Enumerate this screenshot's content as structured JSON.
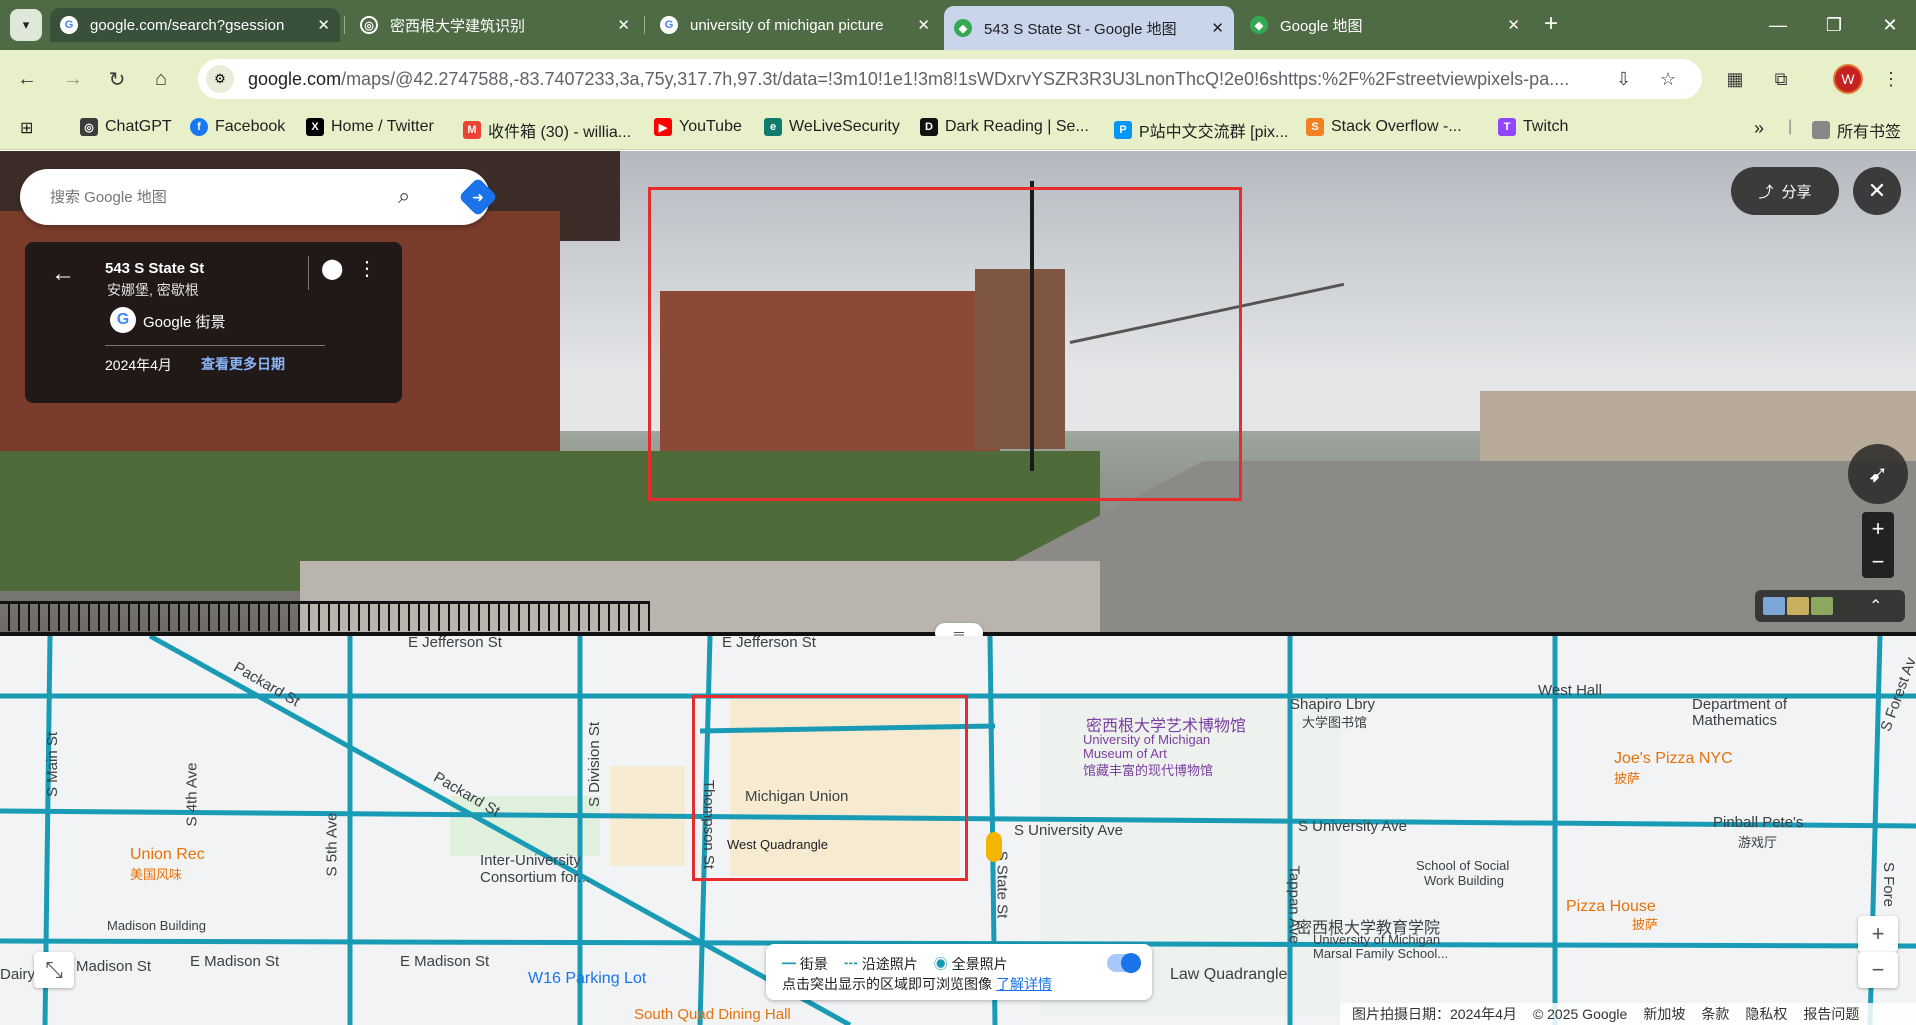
{
  "tabs": [
    {
      "title": "google.com/search?gsession",
      "close": "✕"
    },
    {
      "title": "密西根大学建筑识别",
      "close": "✕"
    },
    {
      "title": "university of michigan picture",
      "close": "✕"
    },
    {
      "title": "543 S State St - Google 地图",
      "close": "✕"
    },
    {
      "title": "Google 地图",
      "close": "✕"
    }
  ],
  "new_tab": "+",
  "address_bar": {
    "host": "google.com",
    "path": "/maps/@42.2747588,-83.7407233,3a,75y,317.7h,97.3t/data=!3m10!1e1!3m8!1sWDxrvYSZR3R3U3LnonThcQ!2e0!6shttps:%2F%2Fstreetviewpixels-pa...."
  },
  "profile_initial": "W",
  "bookmarks": [
    {
      "label": "ChatGPT",
      "color": "#3c3c3c"
    },
    {
      "label": "Facebook",
      "color": "#1877f2"
    },
    {
      "label": "Home / Twitter",
      "color": "#000000"
    },
    {
      "label": "收件箱 (30) - willia...",
      "color": "#ea4335"
    },
    {
      "label": "YouTube",
      "color": "#ff0000"
    },
    {
      "label": "WeLiveSecurity",
      "color": "#0f7b6c"
    },
    {
      "label": "Dark Reading | Se...",
      "color": "#111111"
    },
    {
      "label": "P站中文交流群 [pix...",
      "color": "#0096fa"
    },
    {
      "label": "Stack Overflow -...",
      "color": "#f48024"
    },
    {
      "label": "Twitch",
      "color": "#9146ff"
    }
  ],
  "bookmarks_overflow": "»",
  "all_bookmarks": "所有书签",
  "search": {
    "placeholder": "搜索 Google 地图"
  },
  "info_card": {
    "address": "543 S State St",
    "city": "安娜堡, 密歇根",
    "source": "Google 街景",
    "date": "2024年4月",
    "more_dates": "查看更多日期"
  },
  "share_label": "分享",
  "map_labels": {
    "e_jefferson_1": "E Jefferson St",
    "e_jefferson_2": "E Jefferson St",
    "packard_1": "Packard St",
    "packard_2": "Packard St",
    "s_main": "S Main St",
    "s_4th": "S 4th Ave",
    "s_5th": "S 5th Ave",
    "s_division": "S Division St",
    "thompson": "Thompson St",
    "s_state": "S State St",
    "s_university_1": "S University Ave",
    "s_university_2": "S University Ave",
    "tappan": "Tappan Ave",
    "e_madison_1": "E Madison St",
    "e_madison_2": "E Madison St",
    "madison_left": "Madison St",
    "dairy": "Dairy",
    "michigan_union": "Michigan Union",
    "west_quad": "West Quadrangle",
    "museum_cn": "密西根大学艺术博物馆",
    "museum_en1": "University of Michigan",
    "museum_en2": "Museum of Art",
    "museum_cn2": "馆藏丰富的现代博物馆",
    "shapiro": "Shapiro Lbry",
    "shapiro_cn": "大学图书馆",
    "west_hall": "West Hall",
    "dept_math1": "Department of",
    "dept_math2": "Mathematics",
    "joes": "Joe's Pizza NYC",
    "joes_cn": "披萨",
    "pinball": "Pinball Pete's",
    "pinball_cn": "游戏厅",
    "union_rec": "Union Rec",
    "union_rec_cn": "美国风味",
    "icpsr1": "Inter-University",
    "icpsr2": "Consortium for...",
    "madison_bldg": "Madison Building",
    "school_social1": "School of Social",
    "school_social2": "Work Building",
    "edu_cn": "密西根大学教育学院",
    "edu_en1": "University of Michigan",
    "edu_en2": "Marsal Family School...",
    "pizza_house": "Pizza House",
    "pizza_house_cn": "披萨",
    "w16": "W16 Parking Lot",
    "law_quad": "Law Quadrangle",
    "south_quad": "South Quad Dining Hall",
    "s_forest": "S Forest Av",
    "s_fore2": "S Fore"
  },
  "legend": {
    "streetview": "街景",
    "along_route": "沿途照片",
    "panorama": "全景照片",
    "hint": "点击突出显示的区域即可浏览图像",
    "learn_more": "了解详情"
  },
  "footer": {
    "capture_date": "图片拍摄日期：2024年4月",
    "copyright": "© 2025 Google",
    "region": "新加坡",
    "terms": "条款",
    "privacy": "隐私权",
    "report": "报告问题"
  },
  "colors": {
    "streetview_line": "#1a9bb5",
    "highlight_box": "#e52d2d",
    "accent": "#1a73e8"
  },
  "icons": [
    "search-icon",
    "directions-icon",
    "back-arrow-icon",
    "pin-icon",
    "more-icon",
    "share-icon",
    "close-icon",
    "compass-icon",
    "zoom-in-icon",
    "zoom-out-icon",
    "pegman-icon"
  ]
}
